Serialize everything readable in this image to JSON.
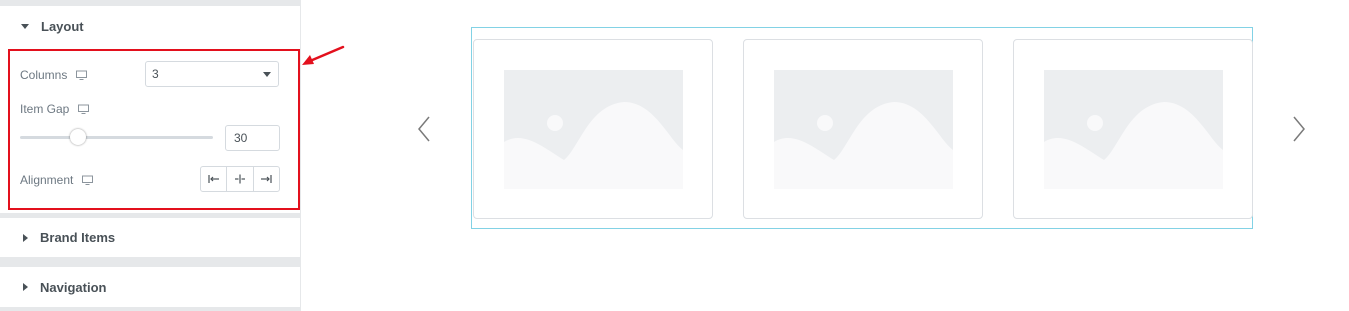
{
  "panel": {
    "layout": {
      "title": "Layout",
      "columns_label": "Columns",
      "columns_value": "3",
      "item_gap_label": "Item Gap",
      "item_gap_value": "30",
      "item_gap_slider_fraction": 0.3,
      "alignment_label": "Alignment",
      "alignment_options": [
        "align-left-icon",
        "align-center-icon",
        "align-right-icon"
      ],
      "device_icon": "monitor-icon"
    },
    "brand_items": {
      "title": "Brand Items"
    },
    "navigation": {
      "title": "Navigation"
    }
  },
  "annotation": {
    "highlight_color": "#e3101d",
    "arrow_color": "#e3101d"
  },
  "preview": {
    "cards": [
      {
        "image": "image-placeholder-icon"
      },
      {
        "image": "image-placeholder-icon"
      },
      {
        "image": "image-placeholder-icon"
      }
    ],
    "prev_icon": "chevron-left-icon",
    "next_icon": "chevron-right-icon",
    "border_color": "#82d2e5"
  }
}
